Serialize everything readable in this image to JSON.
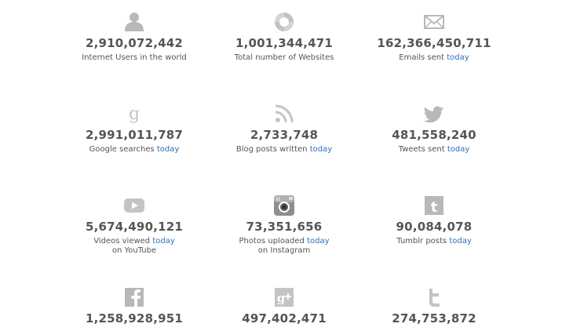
{
  "stats": [
    {
      "icon": "person-icon",
      "value": "2,910,072,442",
      "label": "Internet Users in the world",
      "today": "",
      "line2": ""
    },
    {
      "icon": "globe-icon",
      "value": "1,001,344,471",
      "label": "Total number of Websites",
      "today": "",
      "line2": ""
    },
    {
      "icon": "envelope-icon",
      "value": "162,366,450,711",
      "label": "Emails sent",
      "today": "today",
      "line2": ""
    },
    {
      "icon": "google-g-icon",
      "value": "2,991,011,787",
      "label": "Google searches",
      "today": "today",
      "line2": ""
    },
    {
      "icon": "rss-icon",
      "value": "2,733,748",
      "label": "Blog posts written",
      "today": "today",
      "line2": ""
    },
    {
      "icon": "twitter-bird-icon",
      "value": "481,558,240",
      "label": "Tweets sent",
      "today": "today",
      "line2": ""
    },
    {
      "icon": "youtube-icon",
      "value": "5,674,490,121",
      "label": "Videos viewed",
      "today": "today",
      "line2": "on YouTube"
    },
    {
      "icon": "instagram-camera-icon",
      "value": "73,351,656",
      "label": "Photos uploaded",
      "today": "today",
      "line2": "on Instagram"
    },
    {
      "icon": "tumblr-icon",
      "value": "90,084,078",
      "label": "Tumblr posts",
      "today": "today",
      "line2": ""
    },
    {
      "icon": "facebook-icon",
      "value": "1,258,928,951",
      "label": "",
      "today": "",
      "line2": ""
    },
    {
      "icon": "google-plus-icon",
      "value": "497,402,471",
      "label": "",
      "today": "",
      "line2": ""
    },
    {
      "icon": "twitter-t-icon",
      "value": "274,753,872",
      "label": "",
      "today": "",
      "line2": ""
    }
  ],
  "colors": {
    "icon": "#bdbdbd",
    "text": "#555555",
    "today": "#2e6fb8"
  }
}
